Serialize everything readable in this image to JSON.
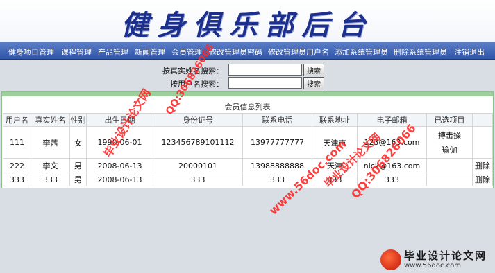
{
  "banner": {
    "title": "健身俱乐部后台"
  },
  "nav": {
    "items": [
      "健身项目管理",
      "课程管理",
      "产品管理",
      "新闻管理",
      "会员管理",
      "修改管理员密码",
      "修改管理员用户名",
      "添加系统管理员",
      "删除系统管理员",
      "注销退出"
    ]
  },
  "search": {
    "realname_label": "按真实姓名搜索：",
    "username_label": "按用户名搜索：",
    "realname_value": "",
    "username_value": "",
    "button_label": "搜索"
  },
  "panel": {
    "title": "会员信息列表",
    "columns": [
      "用户名",
      "真实姓名",
      "性别",
      "出生日期",
      "身份证号",
      "联系电话",
      "联系地址",
      "电子邮箱",
      "已选项目",
      ""
    ],
    "rows": [
      {
        "username": "111",
        "realname": "李茜",
        "gender": "女",
        "birth": "1990-06-01",
        "id": "123456789101112",
        "phone": "13977777777",
        "address": "天津市",
        "email": "123@163.com",
        "projects": [
          "搏击操",
          "瑜伽"
        ],
        "action": ""
      },
      {
        "username": "222",
        "realname": "李文",
        "gender": "男",
        "birth": "2008-06-13",
        "id": "20000101",
        "phone": "13988888888",
        "address": "天津",
        "email": "nick@163.com",
        "projects": [],
        "action": "删除"
      },
      {
        "username": "333",
        "realname": "333",
        "gender": "男",
        "birth": "2008-06-13",
        "id": "333",
        "phone": "333",
        "address": "333",
        "email": "333",
        "projects": [],
        "action": "删除"
      }
    ]
  },
  "watermarks": [
    "毕业设计论文网",
    "QQ:306826066",
    "www.56doc.com",
    "毕业设计论文网",
    "QQ:306826066"
  ],
  "logo": {
    "title": "毕业设计论文网",
    "url": "www.56doc.com"
  }
}
